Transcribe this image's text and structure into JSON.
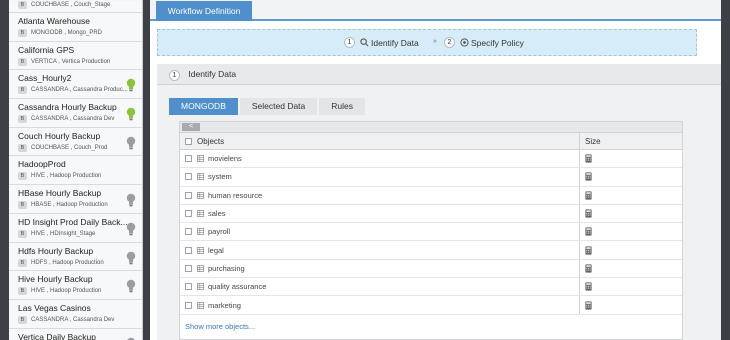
{
  "sidebar": {
    "items": [
      {
        "name": "",
        "badge": "B",
        "sub": "COUCHBASE , Couch_Stage",
        "bulb": "none"
      },
      {
        "name": "Atlanta Warehouse",
        "badge": "B",
        "sub": "MONGODB , Mongo_PRD",
        "bulb": "none"
      },
      {
        "name": "California GPS",
        "badge": "B",
        "sub": "VERTICA , Vertica Production",
        "bulb": "none"
      },
      {
        "name": "Cass_Hourly2",
        "badge": "B",
        "sub": "CASSANDRA , Cassandra Produc...",
        "bulb": "green"
      },
      {
        "name": "Cassandra Hourly Backup",
        "badge": "B",
        "sub": "CASSANDRA , Cassandra Dev",
        "bulb": "green"
      },
      {
        "name": "Couch Hourly Backup",
        "badge": "B",
        "sub": "COUCHBASE , Couch_Prod",
        "bulb": "gray"
      },
      {
        "name": "HadoopProd",
        "badge": "B",
        "sub": "HIVE , Hadoop Production",
        "bulb": "none"
      },
      {
        "name": "HBase Hourly Backup",
        "badge": "B",
        "sub": "HBASE , Hadoop Production",
        "bulb": "gray"
      },
      {
        "name": "HD Insight Prod Daily Back...",
        "badge": "B",
        "sub": "HIVE , HDInsight_Stage",
        "bulb": "gray"
      },
      {
        "name": "Hdfs Hourly Backup",
        "badge": "B",
        "sub": "HDFS , Hadoop Production",
        "bulb": "gray"
      },
      {
        "name": "Hive Hourly Backup",
        "badge": "B",
        "sub": "HIVE , Hadoop Production",
        "bulb": "gray"
      },
      {
        "name": "Las Vegas Casinos",
        "badge": "B",
        "sub": "CASSANDRA , Cassandra Dev",
        "bulb": "none"
      },
      {
        "name": "Vertica Daily Backup",
        "badge": "B",
        "sub": "",
        "bulb": "gray"
      }
    ]
  },
  "header": {
    "tab_label": "Workflow Definition"
  },
  "steps": {
    "step1_num": "1",
    "step1_icon": "identify-data-icon",
    "step1_label": "Identify Data",
    "separator": "»",
    "step2_num": "2",
    "step2_icon": "specify-policy-icon",
    "step2_label": "Specify Policy"
  },
  "section": {
    "num": "1",
    "title": "Identify Data"
  },
  "subtabs": [
    "MONGODB",
    "Selected Data",
    "Rules"
  ],
  "table": {
    "scroll_label": "<",
    "col_objects": "Objects",
    "col_size": "Size",
    "rows": [
      "movielens",
      "system",
      "human resource",
      "sales",
      "payroll",
      "legal",
      "purchasing",
      "quality assurance",
      "marketing"
    ],
    "show_more": "Show more objects..."
  },
  "colors": {
    "accent": "#4f8fcb",
    "bulb_green": "#8cc43c",
    "bulb_gray": "#9a9ea3"
  }
}
